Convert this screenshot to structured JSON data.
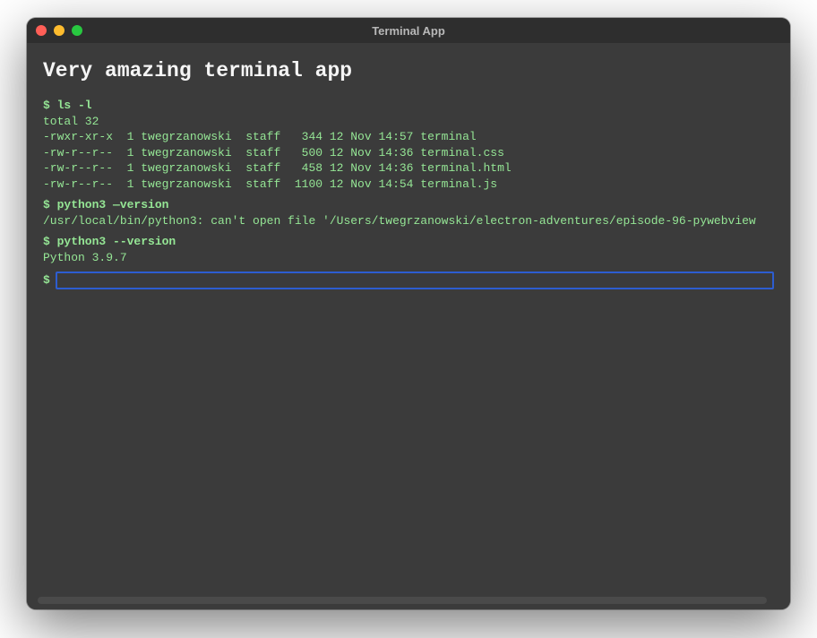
{
  "window": {
    "title": "Terminal App"
  },
  "terminal": {
    "heading": "Very amazing terminal app",
    "prompt": "$",
    "history": [
      {
        "command": "ls -l",
        "output": "total 32\n-rwxr-xr-x  1 twegrzanowski  staff   344 12 Nov 14:57 terminal\n-rw-r--r--  1 twegrzanowski  staff   500 12 Nov 14:36 terminal.css\n-rw-r--r--  1 twegrzanowski  staff   458 12 Nov 14:36 terminal.html\n-rw-r--r--  1 twegrzanowski  staff  1100 12 Nov 14:54 terminal.js"
      },
      {
        "command": "python3 —version",
        "output": "/usr/local/bin/python3: can't open file '/Users/twegrzanowski/electron-adventures/episode-96-pywebview"
      },
      {
        "command": "python3 --version",
        "output": "Python 3.9.7"
      }
    ],
    "input_value": ""
  }
}
